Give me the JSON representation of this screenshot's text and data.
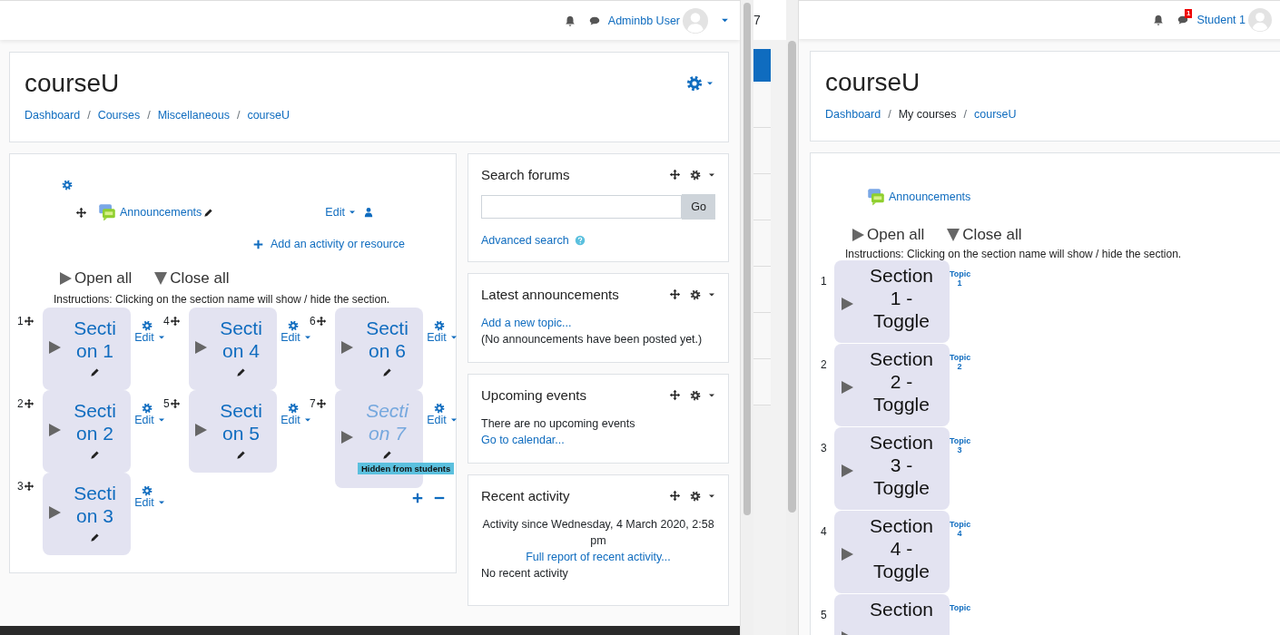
{
  "admin_window": {
    "header": {
      "user_name": "Adminbb User"
    },
    "course_header": {
      "title": "courseU",
      "breadcrumbs": {
        "separator": "/",
        "items": [
          {
            "label": "Dashboard",
            "link": true
          },
          {
            "label": "Courses",
            "link": true
          },
          {
            "label": "Miscellaneous",
            "link": true
          },
          {
            "label": "courseU",
            "link": true
          }
        ]
      }
    },
    "course_content": {
      "activity": {
        "name": "Announcements",
        "edit": "Edit"
      },
      "add_activity": "Add an activity or resource",
      "open_all": "Open all",
      "close_all": "Close all",
      "instructions": "Instructions: Clicking on the section name will show / hide the section.",
      "section_columns": [
        [
          {
            "number": "1",
            "title": "Section 1",
            "edit": "Edit",
            "hidden": false
          },
          {
            "number": "2",
            "title": "Section 2",
            "edit": "Edit",
            "hidden": false
          },
          {
            "number": "3",
            "title": "Section 3",
            "edit": "Edit",
            "hidden": false
          }
        ],
        [
          {
            "number": "4",
            "title": "Section 4",
            "edit": "Edit",
            "hidden": false
          },
          {
            "number": "5",
            "title": "Section 5",
            "edit": "Edit",
            "hidden": false
          }
        ],
        [
          {
            "number": "6",
            "title": "Section 6",
            "edit": "Edit",
            "hidden": false
          },
          {
            "number": "7",
            "title": "Section 7",
            "edit": "Edit",
            "hidden": true,
            "badge": "Hidden from students"
          }
        ]
      ]
    },
    "blocks": [
      {
        "kind": "search",
        "title": "Search forums",
        "button": "Go",
        "link": "Advanced search"
      },
      {
        "kind": "announcements",
        "title": "Latest announcements",
        "link": "Add a new topic...",
        "text": "(No announcements have been posted yet.)"
      },
      {
        "kind": "events",
        "title": "Upcoming events",
        "text": "There are no upcoming events",
        "link": "Go to calendar..."
      },
      {
        "kind": "activity",
        "title": "Recent activity",
        "text": "Activity since Wednesday, 4 March 2020, 2:58 pm",
        "link": "Full report of recent activity...",
        "note": "No recent activity"
      }
    ]
  },
  "background_window": {
    "text": "7"
  },
  "student_window": {
    "header": {
      "message_count": "1",
      "user_name": "Student 1"
    },
    "course_header": {
      "title": "courseU",
      "breadcrumbs": {
        "separator": "/",
        "items": [
          {
            "label": "Dashboard",
            "link": true
          },
          {
            "label": "My courses",
            "link": false
          },
          {
            "label": "courseU",
            "link": true
          }
        ]
      }
    },
    "course_content": {
      "activity": {
        "name": "Announcements"
      },
      "open_all": "Open all",
      "close_all": "Close all",
      "instructions": "Instructions: Clicking on the section name will show / hide the section.",
      "sections": [
        {
          "number": "1",
          "title": "Section 1 - Toggle",
          "topic": "Topic 1"
        },
        {
          "number": "2",
          "title": "Section 2 - Toggle",
          "topic": "Topic 2"
        },
        {
          "number": "3",
          "title": "Section 3 - Toggle",
          "topic": "Topic 3"
        },
        {
          "number": "4",
          "title": "Section 4 - Toggle",
          "topic": "Topic 4"
        },
        {
          "number": "5",
          "title": "Section",
          "topic": "Topic"
        }
      ]
    }
  }
}
